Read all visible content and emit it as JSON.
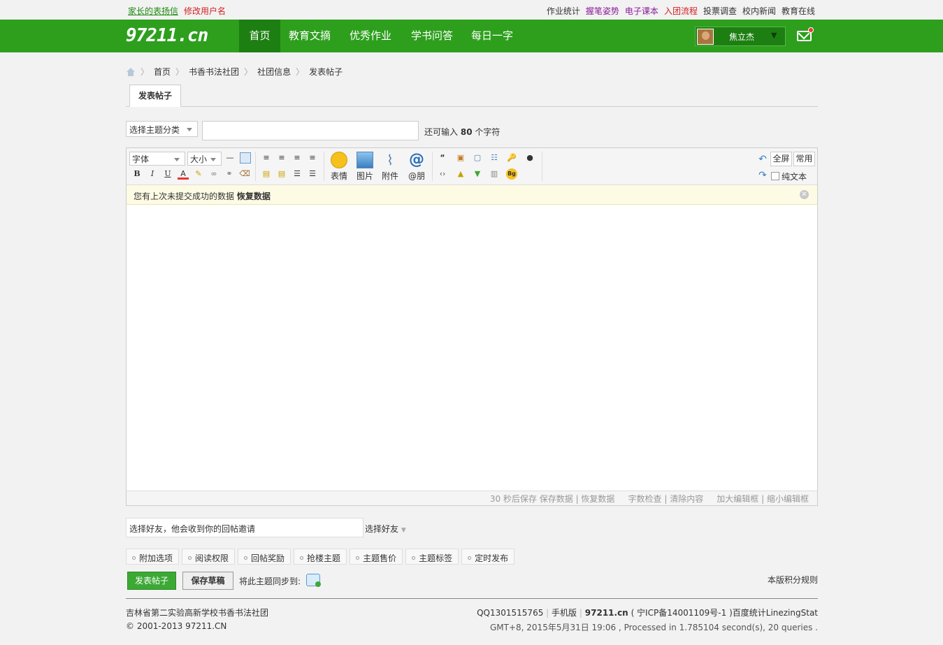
{
  "topbar": {
    "left": [
      {
        "label": "家长的表扬信",
        "color": "#1f8b12",
        "underline": true
      },
      {
        "label": "修改用户名",
        "color": "#d42020",
        "underline": false
      }
    ],
    "right": [
      {
        "label": "作业统计",
        "color": "#333333"
      },
      {
        "label": "握笔姿势",
        "color": "#8a1b9a"
      },
      {
        "label": "电子课本",
        "color": "#8a1b9a"
      },
      {
        "label": "入团流程",
        "color": "#d42020"
      },
      {
        "label": "投票调查",
        "color": "#333333"
      },
      {
        "label": "校内新闻",
        "color": "#333333"
      },
      {
        "label": "教育在线",
        "color": "#333333"
      }
    ]
  },
  "nav": {
    "logo": "97211.cn",
    "items": [
      "首页",
      "教育文摘",
      "优秀作业",
      "学书问答",
      "每日一字"
    ],
    "active": 0,
    "user": "焦立杰",
    "user_arrow": "▼"
  },
  "breadcrumb": [
    "首页",
    "书香书法社团",
    "社团信息",
    "发表帖子"
  ],
  "tab": "发表帖子",
  "form": {
    "type_select": "选择主题分类",
    "remain_prefix": "还可输入",
    "remain_count": "80",
    "remain_suffix": "个字符"
  },
  "editor": {
    "font_select": "字体",
    "size_select": "大小",
    "big_buttons": [
      "表情",
      "图片",
      "附件",
      "@朋"
    ],
    "fullscreen": "全屏",
    "common": "常用",
    "plaintext": "纯文本",
    "notice_text": "您有上次未提交成功的数据",
    "notice_link": "恢复数据",
    "status": {
      "autosave": "30 秒后保存",
      "save": "保存数据",
      "restore": "恢复数据",
      "count": "字数检查",
      "clear": "清除内容",
      "enlarge": "加大编辑框",
      "shrink": "缩小编辑框"
    }
  },
  "invite": {
    "placeholder": "选择好友，他会收到你的回帖邀请",
    "select": "选择好友"
  },
  "options": [
    "附加选项",
    "阅读权限",
    "回帖奖励",
    "抢楼主题",
    "主题售价",
    "主题标签",
    "定时发布"
  ],
  "buttons": {
    "post": "发表帖子",
    "draft": "保存草稿",
    "sync_label": "将此主题同步到:"
  },
  "rules_link": "本版积分规则",
  "footer": {
    "site": "吉林省第二实验高新学校书香书法社团",
    "copy_prefix": "© 2001-2013",
    "copy_site": "97211.CN",
    "qq": "QQ1301515765",
    "mobile": "手机版",
    "domain": "97211.cn",
    "icp": "( 宁ICP备14001109号-1 )百度统计LinezingStat",
    "gmt": "GMT+8, 2015年5月31日 19:06 , Processed in 1.785104 second(s), 20 queries ."
  }
}
